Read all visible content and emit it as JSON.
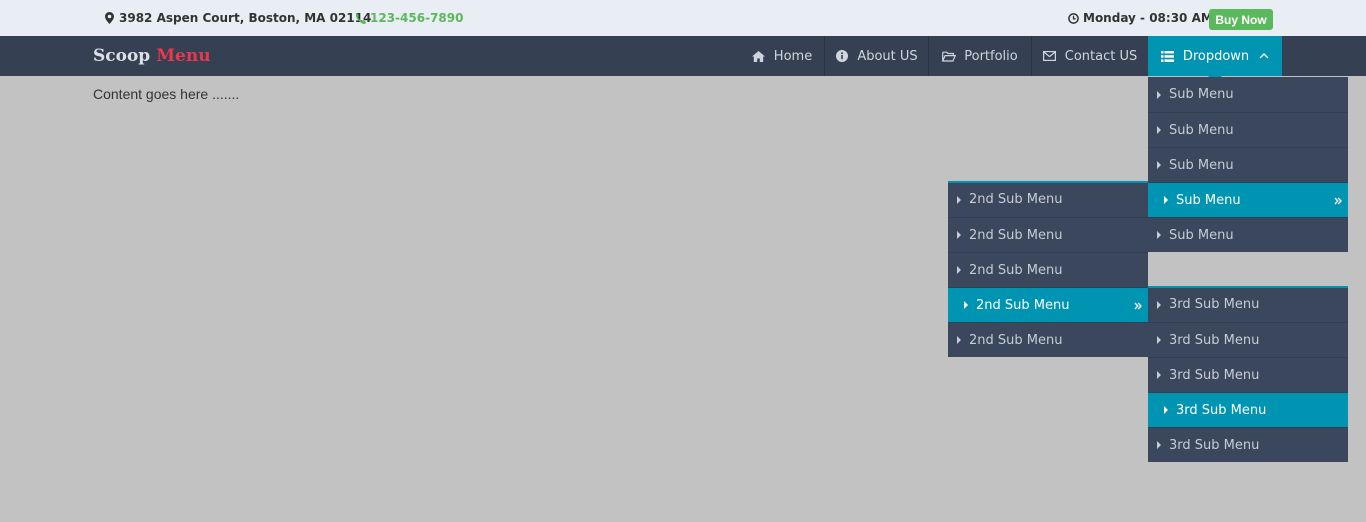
{
  "topbar": {
    "address": "3982 Aspen Court, Boston, MA 02114",
    "phone": "123-456-7890",
    "datetime": "Monday - 08:30 AM",
    "buy_now": "Buy Now"
  },
  "brand": {
    "part1": "Scoop",
    "part2": "Menu"
  },
  "nav": {
    "items": [
      {
        "label": "Home",
        "icon": "home-icon"
      },
      {
        "label": "About US",
        "icon": "info-icon"
      },
      {
        "label": "Portfolio",
        "icon": "folder-icon"
      },
      {
        "label": "Contact US",
        "icon": "envelope-icon"
      },
      {
        "label": "Dropdown",
        "icon": "list-icon"
      }
    ]
  },
  "content": {
    "text": "Content goes here ......."
  },
  "menus": {
    "level1": [
      "Sub Menu",
      "Sub Menu",
      "Sub Menu",
      "Sub Menu",
      "Sub Menu"
    ],
    "level2": [
      "2nd Sub Menu",
      "2nd Sub Menu",
      "2nd Sub Menu",
      "2nd Sub Menu",
      "2nd Sub Menu"
    ],
    "level3": [
      "3rd Sub Menu",
      "3rd Sub Menu",
      "3rd Sub Menu",
      "3rd Sub Menu",
      "3rd Sub Menu"
    ]
  },
  "colors": {
    "accent": "#0094b3",
    "navbar": "#354052",
    "menu": "#3b475c",
    "green": "#5cb85c",
    "brand_red": "#e8384f"
  }
}
